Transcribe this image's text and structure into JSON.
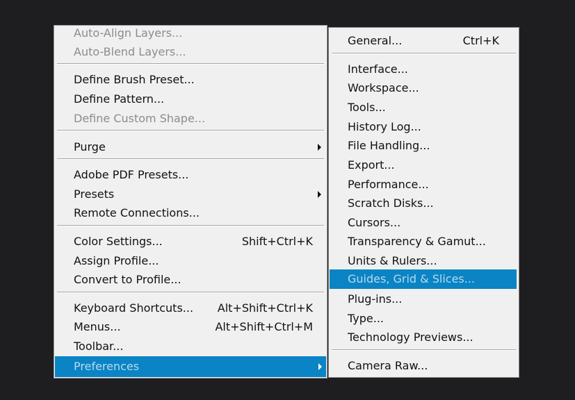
{
  "edit_menu": {
    "items": [
      {
        "label": "Auto-Align Layers...",
        "enabled": false
      },
      {
        "label": "Auto-Blend Layers...",
        "enabled": false
      },
      {
        "label": "Define Brush Preset...",
        "enabled": true
      },
      {
        "label": "Define Pattern...",
        "enabled": true
      },
      {
        "label": "Define Custom Shape...",
        "enabled": false
      },
      {
        "label": "Purge",
        "enabled": true,
        "submenu": true
      },
      {
        "label": "Adobe PDF Presets...",
        "enabled": true
      },
      {
        "label": "Presets",
        "enabled": true,
        "submenu": true
      },
      {
        "label": "Remote Connections...",
        "enabled": true
      },
      {
        "label": "Color Settings...",
        "shortcut": "Shift+Ctrl+K",
        "enabled": true
      },
      {
        "label": "Assign Profile...",
        "enabled": true
      },
      {
        "label": "Convert to Profile...",
        "enabled": true
      },
      {
        "label": "Keyboard Shortcuts...",
        "shortcut": "Alt+Shift+Ctrl+K",
        "enabled": true
      },
      {
        "label": "Menus...",
        "shortcut": "Alt+Shift+Ctrl+M",
        "enabled": true
      },
      {
        "label": "Toolbar...",
        "enabled": true
      },
      {
        "label": "Preferences",
        "enabled": true,
        "submenu": true,
        "highlighted": true
      }
    ]
  },
  "preferences_submenu": {
    "items": [
      {
        "label": "General...",
        "shortcut": "Ctrl+K"
      },
      {
        "label": "Interface..."
      },
      {
        "label": "Workspace..."
      },
      {
        "label": "Tools..."
      },
      {
        "label": "History Log..."
      },
      {
        "label": "File Handling..."
      },
      {
        "label": "Export..."
      },
      {
        "label": "Performance..."
      },
      {
        "label": "Scratch Disks..."
      },
      {
        "label": "Cursors..."
      },
      {
        "label": "Transparency & Gamut..."
      },
      {
        "label": "Units & Rulers..."
      },
      {
        "label": "Guides, Grid & Slices...",
        "highlighted": true
      },
      {
        "label": "Plug-ins..."
      },
      {
        "label": "Type..."
      },
      {
        "label": "Technology Previews..."
      },
      {
        "label": "Camera Raw..."
      }
    ]
  },
  "colors": {
    "background": "#1e1d1f",
    "menu_bg": "#f0f0f0",
    "highlight": "#0a84c4",
    "disabled_text": "#8c8c8c"
  }
}
